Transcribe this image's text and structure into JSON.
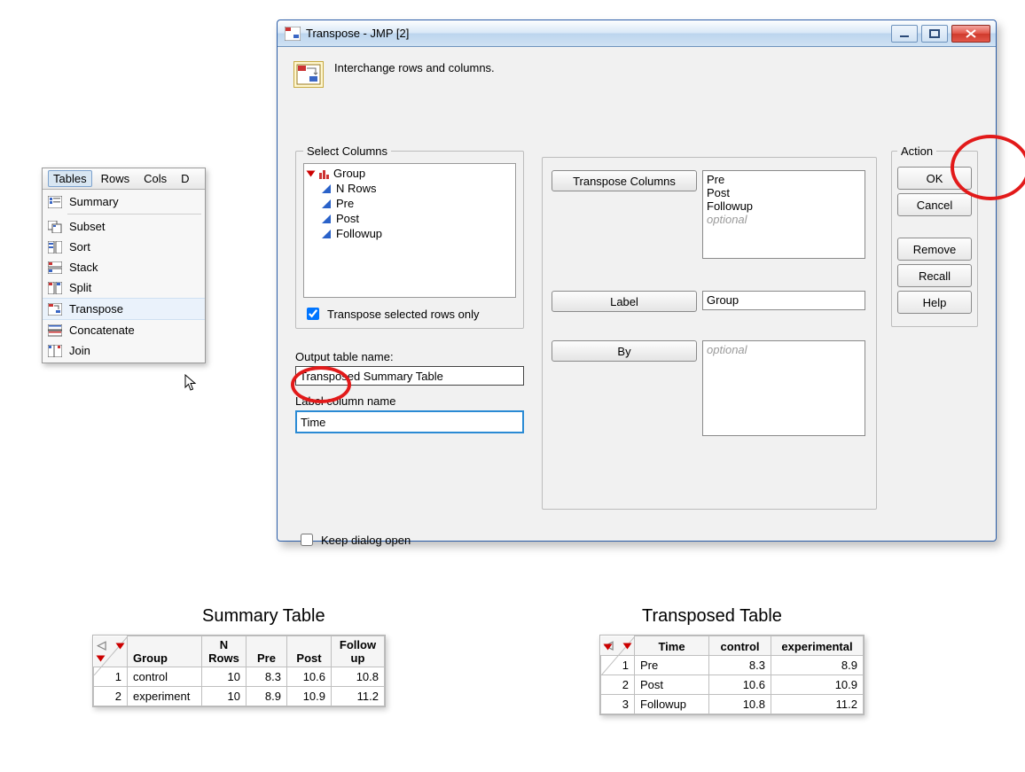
{
  "menu": {
    "bar": {
      "tables": "Tables",
      "rows": "Rows",
      "cols": "Cols",
      "extra": "D"
    },
    "items": [
      "Summary",
      "Subset",
      "Sort",
      "Stack",
      "Split",
      "Transpose",
      "Concatenate",
      "Join"
    ]
  },
  "dialog": {
    "title": "Transpose - JMP [2]",
    "description": "Interchange rows and columns.",
    "select_columns": {
      "legend": "Select Columns",
      "items": [
        "Group",
        "N Rows",
        "Pre",
        "Post",
        "Followup"
      ],
      "checkbox": "Transpose selected rows only"
    },
    "output_table": {
      "label": "Output table name:",
      "value": "Transposed Summary Table"
    },
    "label_column": {
      "label": "Label column name",
      "value": "Time"
    },
    "roles": {
      "transpose_btn": "Transpose Columns",
      "transpose_items": [
        "Pre",
        "Post",
        "Followup"
      ],
      "optional": "optional",
      "label_btn": "Label",
      "label_value": "Group",
      "by_btn": "By",
      "by_value": "optional"
    },
    "action": {
      "legend": "Action",
      "ok": "OK",
      "cancel": "Cancel",
      "remove": "Remove",
      "recall": "Recall",
      "help": "Help"
    },
    "keep_open": "Keep dialog open"
  },
  "summary_caption": "Summary Table",
  "transposed_caption": "Transposed Table",
  "summary_table": {
    "headers": [
      "Group",
      "N Rows",
      "Pre",
      "Post",
      "Follow up"
    ],
    "rows": [
      {
        "n": "1",
        "cells": [
          "control",
          "10",
          "8.3",
          "10.6",
          "10.8"
        ]
      },
      {
        "n": "2",
        "cells": [
          "experiment",
          "10",
          "8.9",
          "10.9",
          "11.2"
        ]
      }
    ]
  },
  "transposed_table": {
    "headers": [
      "Time",
      "control",
      "experimental"
    ],
    "rows": [
      {
        "n": "1",
        "cells": [
          "Pre",
          "8.3",
          "8.9"
        ]
      },
      {
        "n": "2",
        "cells": [
          "Post",
          "10.6",
          "10.9"
        ]
      },
      {
        "n": "3",
        "cells": [
          "Followup",
          "10.8",
          "11.2"
        ]
      }
    ]
  }
}
